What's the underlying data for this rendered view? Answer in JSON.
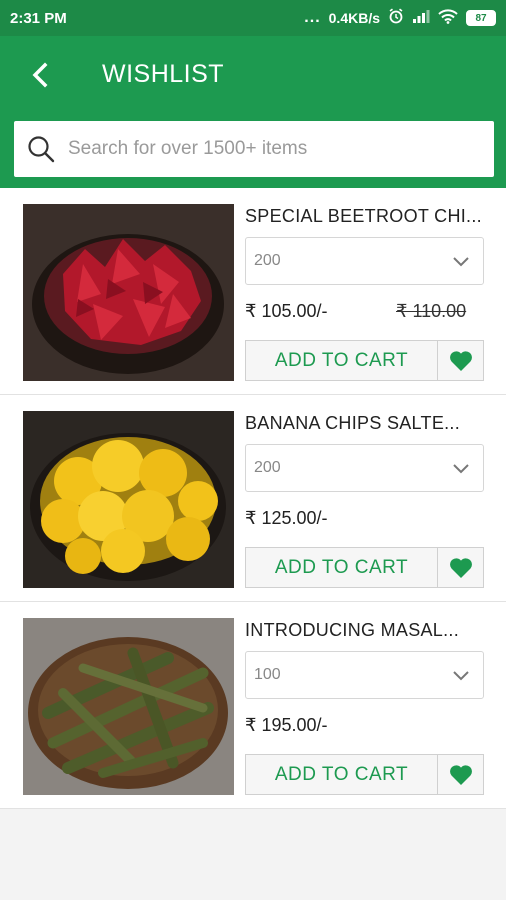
{
  "status_bar": {
    "time": "2:31 PM",
    "dots": "...",
    "speed": "0.4KB/s",
    "battery": "87"
  },
  "app_bar": {
    "title": "WISHLIST",
    "back_icon": "chevron-left-icon"
  },
  "search": {
    "placeholder": "Search for over 1500+ items",
    "icon": "search-icon"
  },
  "colors": {
    "primary": "#1d9a50",
    "status_bar": "#1d8a47",
    "heart": "#1d9a50"
  },
  "items": [
    {
      "name": "SPECIAL BEETROOT CHI...",
      "quantity": "200",
      "price": "₹ 105.00/-",
      "mrp": "₹ 110.00",
      "add_to_cart": "ADD TO CART",
      "image": "beetroot-chips-photo"
    },
    {
      "name": "BANANA CHIPS  SALTE...",
      "quantity": "200",
      "price": "₹ 125.00/-",
      "mrp": "",
      "add_to_cart": "ADD TO CART",
      "image": "banana-chips-photo"
    },
    {
      "name": "INTRODUCING MASAL...",
      "quantity": "100",
      "price": "₹ 195.00/-",
      "mrp": "",
      "add_to_cart": "ADD TO CART",
      "image": "masala-okra-photo"
    }
  ]
}
